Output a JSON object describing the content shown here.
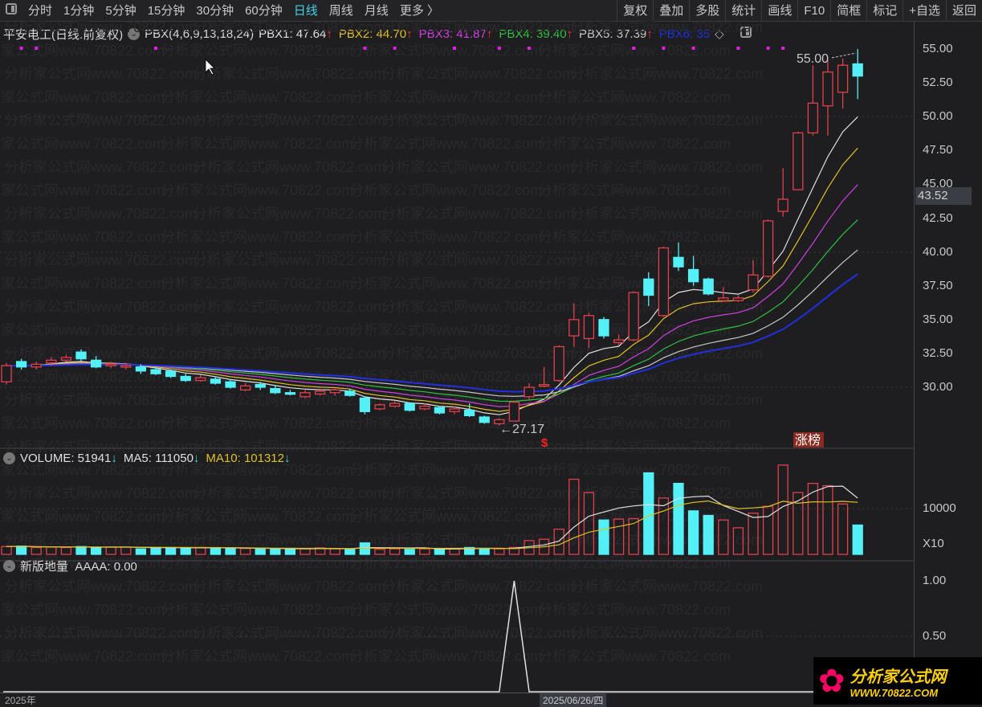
{
  "toolbar": {
    "periods": [
      "分时",
      "1分钟",
      "5分钟",
      "15分钟",
      "30分钟",
      "60分钟",
      "日线",
      "周线",
      "月线",
      "更多 〉"
    ],
    "active": "日线",
    "actions": [
      "复权",
      "叠加",
      "多股",
      "统计",
      "画线",
      "F10",
      "简框",
      "标记",
      "+自选",
      "返回"
    ]
  },
  "header": {
    "title": "平安电工(日线.前复权)",
    "indicator": "PBX(4,6,9,13,18,24)",
    "values": [
      {
        "label": "PBX1: 47.64",
        "color": "#e0e0e0"
      },
      {
        "label": "PBX2: 44.70",
        "color": "#e0c020"
      },
      {
        "label": "PBX3: 41.87",
        "color": "#d040e0"
      },
      {
        "label": "PBX4: 39.40",
        "color": "#30c040"
      },
      {
        "label": "PBX5: 37.39",
        "color": "#c8c8c8"
      },
      {
        "label": "PBX6: 35",
        "color": "#2030e0"
      }
    ]
  },
  "price_axis": {
    "ticks": [
      "55.00",
      "52.50",
      "50.00",
      "47.50",
      "45.00",
      "42.50",
      "40.00",
      "37.50",
      "35.00",
      "32.50",
      "30.00"
    ],
    "current": "43.52"
  },
  "annotations": {
    "high": "55.00",
    "low": "27.17",
    "rank_badge": "涨榜",
    "signal": "$"
  },
  "volume_panel": {
    "header": [
      {
        "label": "VOLUME: 51941",
        "color": "#e0e0e0"
      },
      {
        "label": "MA5: 111050",
        "color": "#e0e0e0"
      },
      {
        "label": "MA10: 101312",
        "color": "#e0c020"
      }
    ],
    "tick": "10000",
    "unit": "X10"
  },
  "sub_panel": {
    "header": "新版地量  AAAA: 0.00",
    "ticks": [
      "1.00",
      "0.50"
    ]
  },
  "time_axis": {
    "left": "2025年",
    "cursor": "2025/06/26/四"
  },
  "watermark": "分析家公式网www.70822.com",
  "logo": {
    "name": "分析家公式网",
    "url": "WWW.70822.COM"
  },
  "colors": {
    "up": "#e0404c",
    "down": "#54f0f8",
    "bg": "#1e1e20"
  },
  "chart_data": {
    "type": "candlestick",
    "ylim": [
      27,
      55
    ],
    "ohlc": [
      [
        30.4,
        31.6,
        31.8,
        30.2
      ],
      [
        31.9,
        31.5,
        32.1,
        31.3
      ],
      [
        31.5,
        31.7,
        31.9,
        31.3
      ],
      [
        31.8,
        32.0,
        32.2,
        31.6
      ],
      [
        32.0,
        32.2,
        32.4,
        31.9
      ],
      [
        32.6,
        32.1,
        32.8,
        31.9
      ],
      [
        32.0,
        31.5,
        32.3,
        31.4
      ],
      [
        31.6,
        31.7,
        31.9,
        31.4
      ],
      [
        31.5,
        31.6,
        31.8,
        31.3
      ],
      [
        31.5,
        31.2,
        31.7,
        31.0
      ],
      [
        31.3,
        31.0,
        31.5,
        30.9
      ],
      [
        31.2,
        30.8,
        31.3,
        30.7
      ],
      [
        30.8,
        30.5,
        31.0,
        30.4
      ],
      [
        30.5,
        30.7,
        30.9,
        30.4
      ],
      [
        30.6,
        30.3,
        30.8,
        30.2
      ],
      [
        30.4,
        30.0,
        30.6,
        29.9
      ],
      [
        29.8,
        30.1,
        30.3,
        29.7
      ],
      [
        30.2,
        30.0,
        30.4,
        29.8
      ],
      [
        29.9,
        29.6,
        30.1,
        29.5
      ],
      [
        29.6,
        29.5,
        29.8,
        29.4
      ],
      [
        29.3,
        29.6,
        29.8,
        29.2
      ],
      [
        29.5,
        29.7,
        29.9,
        29.4
      ],
      [
        29.6,
        29.8,
        29.9,
        29.4
      ],
      [
        29.7,
        29.4,
        29.9,
        29.3
      ],
      [
        29.2,
        28.2,
        29.3,
        28.0
      ],
      [
        28.4,
        28.7,
        28.8,
        28.3
      ],
      [
        28.6,
        28.8,
        29.0,
        28.5
      ],
      [
        28.8,
        28.3,
        28.9,
        28.2
      ],
      [
        28.4,
        28.6,
        28.8,
        28.3
      ],
      [
        28.5,
        28.1,
        28.6,
        28.0
      ],
      [
        28.2,
        28.4,
        28.6,
        28.0
      ],
      [
        28.3,
        27.9,
        28.8,
        27.8
      ],
      [
        27.8,
        27.4,
        27.9,
        27.3
      ],
      [
        27.3,
        27.6,
        27.7,
        27.17
      ],
      [
        27.5,
        28.9,
        29.0,
        27.5
      ],
      [
        29.3,
        30.0,
        30.3,
        29.1
      ],
      [
        30.1,
        30.2,
        31.5,
        30.0
      ],
      [
        30.5,
        33.0,
        33.1,
        30.4
      ],
      [
        33.8,
        35.0,
        36.2,
        33.0
      ],
      [
        33.6,
        35.3,
        35.5,
        32.9
      ],
      [
        35.0,
        33.8,
        35.2,
        33.6
      ],
      [
        33.3,
        33.5,
        33.9,
        33.1
      ],
      [
        33.5,
        37.0,
        37.1,
        33.4
      ],
      [
        38.0,
        36.8,
        38.5,
        36.0
      ],
      [
        35.3,
        40.3,
        40.4,
        35.2
      ],
      [
        39.6,
        38.9,
        40.7,
        38.6
      ],
      [
        38.7,
        37.8,
        39.7,
        37.5
      ],
      [
        38.0,
        36.9,
        38.1,
        36.8
      ],
      [
        36.4,
        36.6,
        37.4,
        36.3
      ],
      [
        36.4,
        36.6,
        36.8,
        36.3
      ],
      [
        37.2,
        38.3,
        39.4,
        37.0
      ],
      [
        38.2,
        42.3,
        42.4,
        38.1
      ],
      [
        43.0,
        43.9,
        46.2,
        42.6
      ],
      [
        44.6,
        48.8,
        48.9,
        44.6
      ],
      [
        48.8,
        51.0,
        53.8,
        48.6
      ],
      [
        50.8,
        53.3,
        54.2,
        48.6
      ],
      [
        51.8,
        53.8,
        54.3,
        50.6
      ],
      [
        53.9,
        53.0,
        55.0,
        51.3
      ]
    ],
    "volume": [
      1700,
      1800,
      1500,
      1600,
      1500,
      1700,
      1500,
      1600,
      1600,
      1200,
      1500,
      1500,
      1400,
      1500,
      1400,
      1300,
      1300,
      1200,
      1200,
      1200,
      1200,
      1400,
      1200,
      1100,
      2500,
      1100,
      1200,
      1100,
      1200,
      1200,
      1200,
      1500,
      1300,
      1200,
      1500,
      3000,
      3300,
      5500,
      16400,
      13500,
      7500,
      7700,
      7800,
      17800,
      12300,
      15500,
      9500,
      8500,
      7500,
      5800,
      9000,
      10500,
      19500,
      13500,
      15500,
      15000,
      11000,
      6400
    ],
    "vol_ylim": [
      0,
      20000
    ],
    "aaaa": {
      "spike_index": 34,
      "values_note": "0 except spike = 1"
    },
    "signal_marks": [
      1,
      2,
      10,
      24,
      26,
      30,
      33,
      35,
      42,
      44,
      46,
      49,
      51,
      52
    ]
  }
}
